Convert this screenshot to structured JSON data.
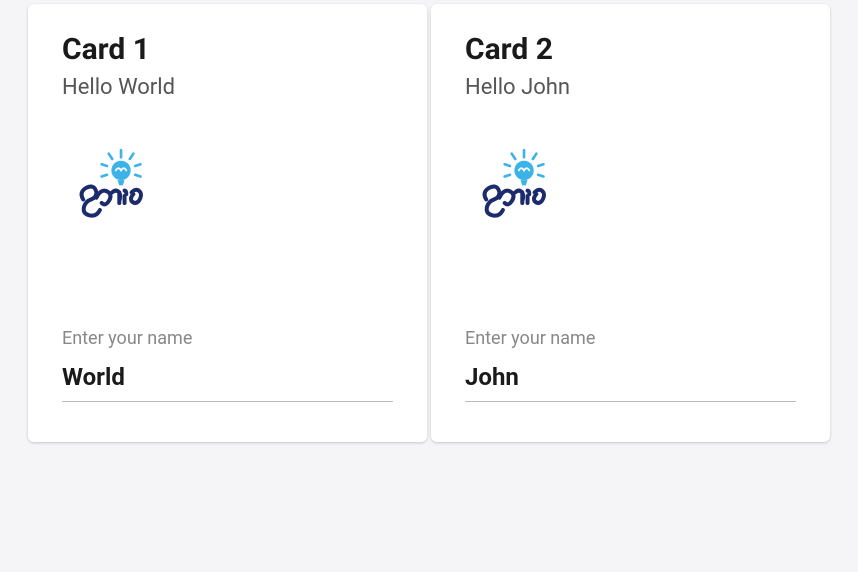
{
  "cards": [
    {
      "title": "Card 1",
      "greeting": "Hello World",
      "input_label": "Enter your name",
      "input_value": "World",
      "logo_name": "genie-logo"
    },
    {
      "title": "Card 2",
      "greeting": "Hello John",
      "input_label": "Enter your name",
      "input_value": "John",
      "logo_name": "genie-logo"
    }
  ]
}
